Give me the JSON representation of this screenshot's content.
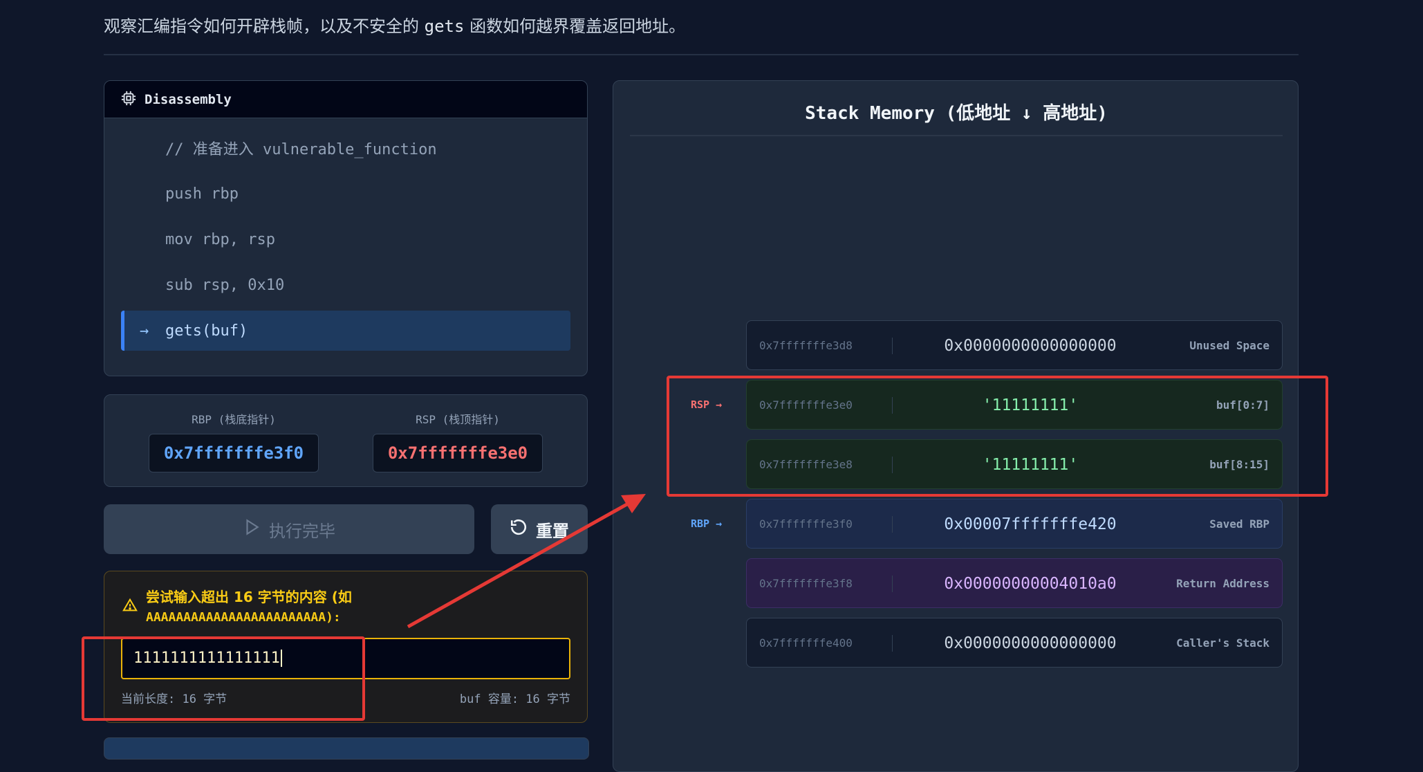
{
  "header": {
    "subtitle_pre": "观察汇编指令如何开辟栈帧，以及不安全的",
    "subtitle_code": "gets",
    "subtitle_post": "函数如何越界覆盖返回地址。"
  },
  "disassembly": {
    "title": "Disassembly",
    "icon": "cpu-icon",
    "active_arrow": "→",
    "lines": [
      {
        "text": "// 准备进入 vulnerable_function",
        "active": false
      },
      {
        "text": "push rbp",
        "active": false
      },
      {
        "text": "mov rbp, rsp",
        "active": false
      },
      {
        "text": "sub rsp, 0x10",
        "active": false
      },
      {
        "text": "gets(buf)",
        "active": true
      }
    ]
  },
  "registers": {
    "rbp_label": "RBP (栈底指针)",
    "rbp_value": "0x7fffffffe3f0",
    "rsp_label": "RSP (栈顶指针)",
    "rsp_value": "0x7fffffffe3e0"
  },
  "controls": {
    "run_label": "执行完毕",
    "run_icon": "play-icon",
    "reset_label": "重置",
    "reset_icon": "rotate-ccw-icon"
  },
  "input": {
    "warning_line1": "尝试输入超出 16 字节的内容 (如",
    "warning_line2": "AAAAAAAAAAAAAAAAAAAAAAAA):",
    "warning_icon": "warning-triangle-icon",
    "value": "1111111111111111",
    "length_text": "当前长度: 16 字节",
    "capacity_text": "buf 容量: 16 字节"
  },
  "stack": {
    "title": "Stack Memory (低地址 ↓ 高地址)",
    "rsp_pointer": "RSP →",
    "rbp_pointer": "RBP →",
    "slots": [
      {
        "addr": "0x7fffffffe3d8",
        "value": "0x0000000000000000",
        "label": "Unused Space"
      },
      {
        "addr": "0x7fffffffe3e0",
        "value": "'11111111'",
        "label": "buf[0:7]"
      },
      {
        "addr": "0x7fffffffe3e8",
        "value": "'11111111'",
        "label": "buf[8:15]"
      },
      {
        "addr": "0x7fffffffe3f0",
        "value": "0x00007fffffffe420",
        "label": "Saved RBP"
      },
      {
        "addr": "0x7fffffffe3f8",
        "value": "0x00000000004010a0",
        "label": "Return Address"
      },
      {
        "addr": "0x7fffffffe400",
        "value": "0x0000000000000000",
        "label": "Caller's Stack"
      }
    ]
  },
  "colors": {
    "accent_blue": "#60a5fa",
    "accent_red": "#f87171",
    "annotation_red": "#e53935",
    "warning_yellow": "#facc15",
    "buf_green": "#86efac"
  }
}
